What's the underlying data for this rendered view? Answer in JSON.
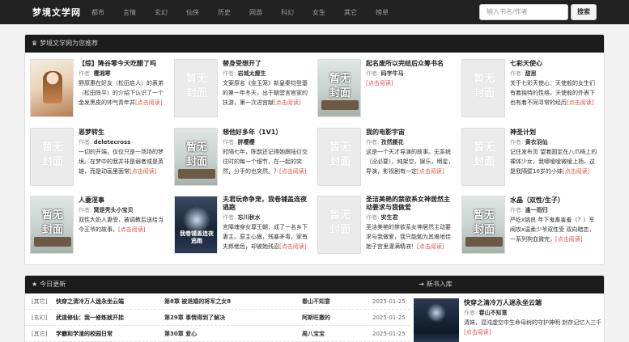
{
  "site": {
    "name": "梦境文学网"
  },
  "nav": [
    "都市",
    "言情",
    "玄幻",
    "仙侠",
    "历史",
    "网游",
    "科幻",
    "女生",
    "其它",
    "榜单"
  ],
  "search": {
    "placeholder": "输入书名/作者",
    "button": "搜索"
  },
  "recommend": {
    "header": "梦境文学网为您推荐",
    "author_label": "作者: ",
    "more_label": "[点击阅读]",
    "placeholder_cover": "暂无封面",
    "books": [
      {
        "title": "【综】降谷零今天吃醋了吗",
        "author": "樱湘寒",
        "desc": "野原惠在好友（松田启人）的表弟（松田阵平）的介绍下认识了一个金发黑皮的帅气青年并",
        "cover": "art1"
      },
      {
        "title": "替身受想开了",
        "author": "岩城太瘦生",
        "desc": "文案原名《金玉笼》新皇秦钧登基的第一年冬天，出于朝堂言官家的扶游，第一次进宫献",
        "cover": "ph"
      },
      {
        "title": "起名废所以完结后众筹书名",
        "author": "码字牛马",
        "desc": "",
        "cover": "scene"
      },
      {
        "title": "七彩天使心",
        "author": "甜思",
        "desc": "关于七彩天使心：天使般的女生们有着独特的性格，天使般的外表下也有着不同寻常的经历",
        "cover": "ph"
      },
      {
        "title": "恶梦转生",
        "author": "deletecross",
        "desc": "一切的开端，仅仅只是一场场的梦境。在梦中的我并非是弱者或是英雄，而是动画里面常",
        "cover": "ph"
      },
      {
        "title": "想他好多年（1V1）",
        "author": "胖樱樱",
        "desc": "时隔七年，陈歆还记得她跟陆衍交往时的每一个细节，在一起的突然，分手的也突然。？",
        "cover": "scene"
      },
      {
        "title": "我的电影宇宙",
        "author": "孜然腰花",
        "desc": "这是一个天才导演的故事。无系统（没必要），纯架空，娱乐，明星，导演，影视剧有一定",
        "cover": "ph"
      },
      {
        "title": "神圣计划",
        "author": "黄衣羽仙",
        "desc": "记住发布页 望着圆定在八爪椅上的裸体少女，我哪嗳嗳微嗳上扬。这是我隔壁16岁的小妹",
        "cover": "ph"
      },
      {
        "title": "人妻淫事",
        "author": "窝是秃头小宝贝",
        "desc": "双性大奶人妻受，被调教后送给当今王爷的故事。",
        "cover": "scene"
      },
      {
        "title": "夫君玩命争宠，我卷铺盖连夜逃跑",
        "author": "忘川秋水",
        "desc": "言降魂穿女尊王朝，成了一名乡下妻主。原主心狠，残暴矛毒，家有夫郎绝色，却被她残忍",
        "cover": "art2",
        "cover_text": "我卷铺盖连夜逃跑"
      },
      {
        "title": "圣洁美艳的禁欲系女神居然主动要求与我做爱",
        "author": "安生君",
        "desc": "圣洁美艳的禁欲系女神居然主动要求与我做爱，我只能勉为其难地佳她子宫里灌满精液！",
        "cover": "ph"
      },
      {
        "title": "水晶（双性/生子）",
        "author": "逢一而归",
        "desc": "严屹x姚良 年下鬼畜害羞（？）军阀攻x温柔少爷双性受 双向暗恋，一系列狗血微完，",
        "cover": "scene"
      }
    ]
  },
  "today": {
    "header": "今日更新",
    "rows": [
      {
        "cat": "[其它]",
        "title": "快穿之清冷万人迷永坐云端",
        "chapter": "第8章 被退婚的将军之女8",
        "author": "春山不知意",
        "date": "2025-01-25"
      },
      {
        "cat": "[玄幻]",
        "title": "武道修仙：我一修炼就开挂",
        "chapter": "第29章 事情得到了解决",
        "author": "阿斯旺撒的",
        "date": "2025-01-25"
      },
      {
        "cat": "[其它]",
        "title": "学霸和学渣的校园日常",
        "chapter": "第30章 爱心",
        "author": "周八宝宝",
        "date": "2025-01-25"
      }
    ]
  },
  "newbooks": {
    "header": "新书入库",
    "book": {
      "title": "快穿之清冷万人迷永坐云端",
      "author": "春山不知意",
      "desc": "清妹，混沌虚空中生命母树的守护神明 封存记忆入三千"
    }
  }
}
